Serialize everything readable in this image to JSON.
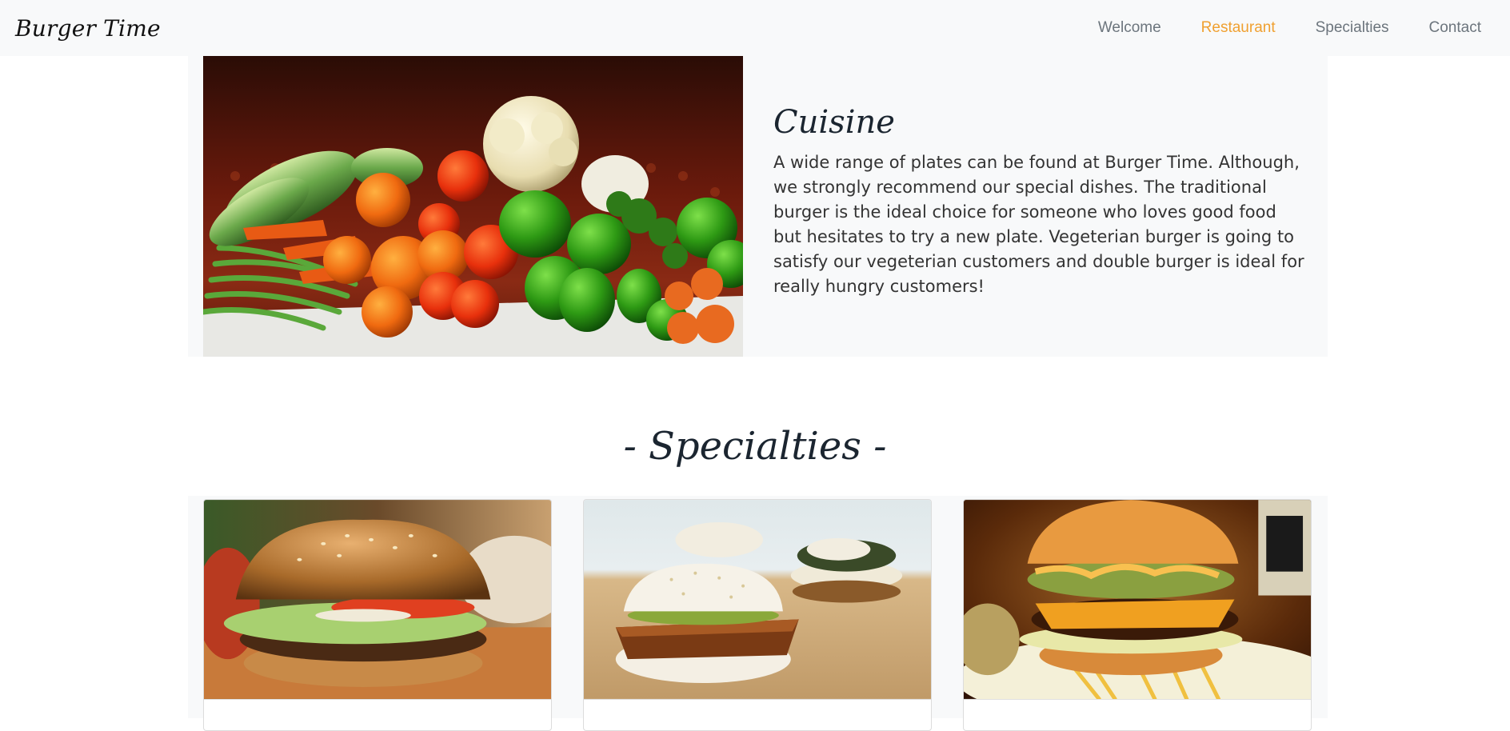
{
  "brand": "Burger Time",
  "nav": {
    "items": [
      {
        "label": "Welcome",
        "active": false
      },
      {
        "label": "Restaurant",
        "active": true
      },
      {
        "label": "Specialties",
        "active": false
      },
      {
        "label": "Contact",
        "active": false
      }
    ],
    "active_color": "#f0a030"
  },
  "cuisine": {
    "title": "Cuisine",
    "body": "A wide range of plates can be found at Burger Time. Although, we strongly recommend our special dishes. The traditional burger is the ideal choice for someone who loves good food but hesitates to try a new plate. Vegeterian burger is going to satisfy our vegeterian customers and double burger is ideal for really hungry customers!"
  },
  "specialties": {
    "title": "- Specialties -"
  }
}
